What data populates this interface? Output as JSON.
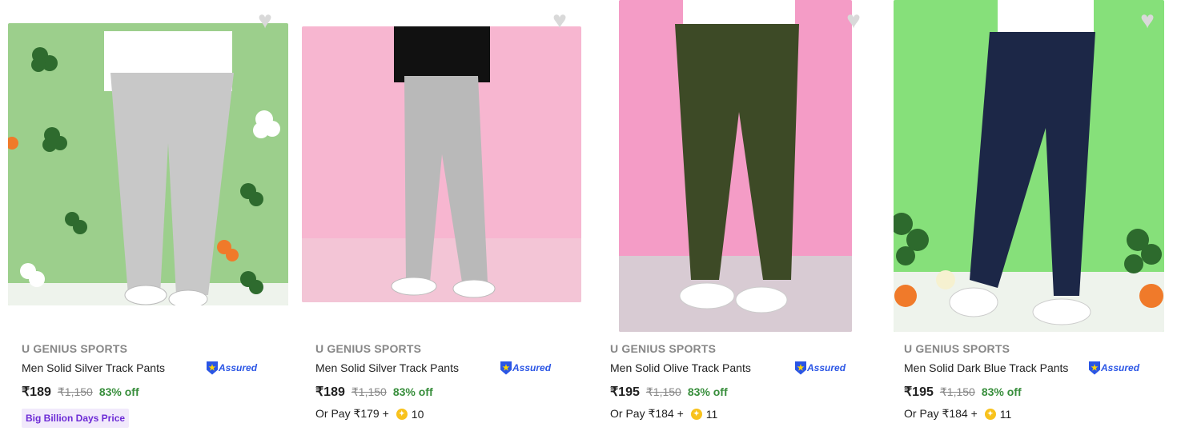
{
  "currency_symbol": "₹",
  "icons": {
    "wishlist": "heart-icon",
    "assured": "shield-icon",
    "supercoin": "coin-icon"
  },
  "colors": {
    "discount": "#388e3c",
    "badge_text": "#6d2bd6",
    "badge_bg": "#f1e9fb",
    "assured": "#2a55e5",
    "wishlist": "#d9d9d9"
  },
  "products": [
    {
      "brand": "U GENIUS SPORTS",
      "title": "Men Solid Silver Track Pants",
      "assured_label": "Assured",
      "price": "₹189",
      "mrp": "₹1,150",
      "discount": "83% off",
      "badge": "Big Billion Days Price",
      "image_bg": "#9ccf8c",
      "pants_color": "#c8c8c8"
    },
    {
      "brand": "U GENIUS SPORTS",
      "title": "Men Solid Silver Track Pants",
      "assured_label": "Assured",
      "price": "₹189",
      "mrp": "₹1,150",
      "discount": "83% off",
      "or_pay_label": "Or Pay ₹179 +",
      "coins": "10",
      "image_bg": "#f7b6d0",
      "pants_color": "#b9b9b9"
    },
    {
      "brand": "U GENIUS SPORTS",
      "title": "Men Solid Olive Track Pants",
      "assured_label": "Assured",
      "price": "₹195",
      "mrp": "₹1,150",
      "discount": "83% off",
      "or_pay_label": "Or Pay ₹184 +",
      "coins": "11",
      "image_bg": "#f49cc6",
      "pants_color": "#3d4a26"
    },
    {
      "brand": "U GENIUS SPORTS",
      "title": "Men Solid Dark Blue Track Pants",
      "assured_label": "Assured",
      "price": "₹195",
      "mrp": "₹1,150",
      "discount": "83% off",
      "or_pay_label": "Or Pay ₹184 +",
      "coins": "11",
      "image_bg": "#86e07a",
      "pants_color": "#1c2747"
    }
  ]
}
